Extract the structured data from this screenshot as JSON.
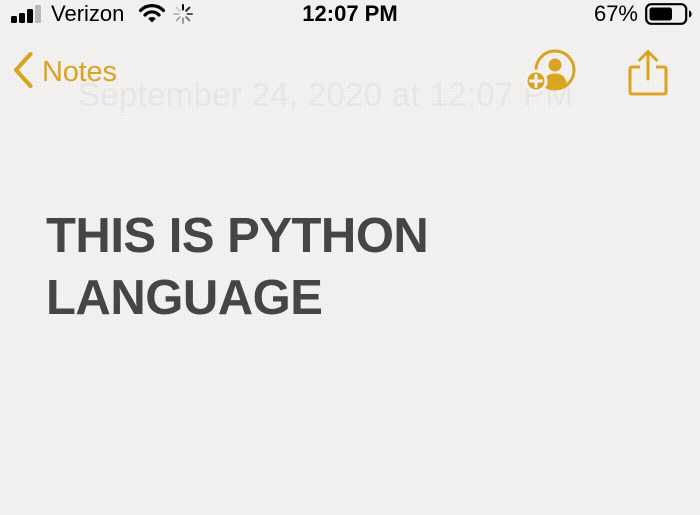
{
  "status_bar": {
    "carrier": "Verizon",
    "time": "12:07 PM",
    "battery_percent": "67%",
    "signal_strength_bars": 3,
    "battery_level": 0.67,
    "icons": [
      "signal-bars-icon",
      "wifi-icon",
      "activity-spinner-icon",
      "battery-icon"
    ]
  },
  "nav": {
    "back_label": "Notes",
    "date_faded": "September 24, 2020 at 12:07 PM",
    "icons": [
      "chevron-left-icon",
      "add-person-icon",
      "share-icon"
    ]
  },
  "note": {
    "lines": [
      "THIS IS PYTHON",
      "LANGUAGE"
    ]
  },
  "colors": {
    "accent": "#d9a520",
    "note_text": "#454545",
    "background": "#f3f2f0"
  }
}
